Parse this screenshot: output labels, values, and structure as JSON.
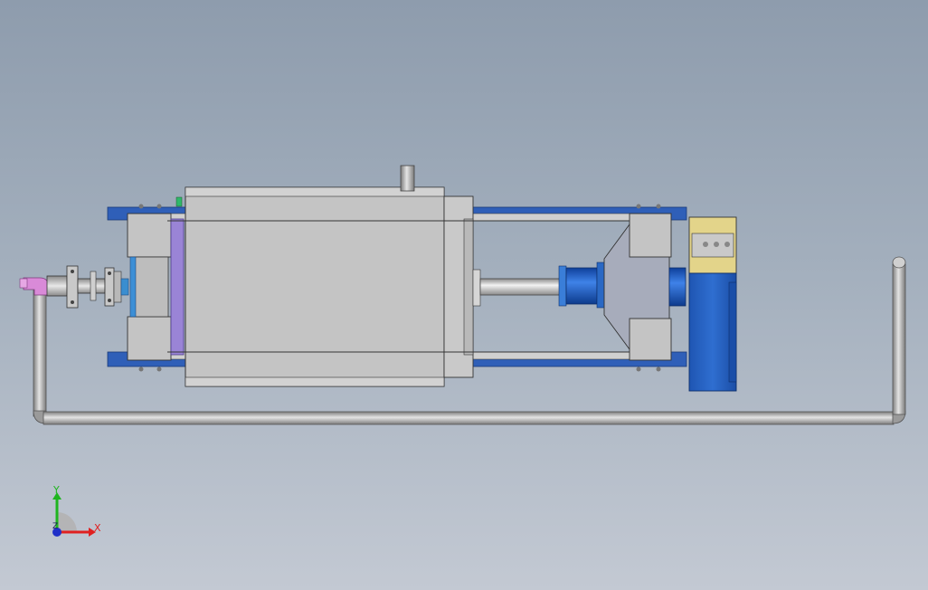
{
  "viewport": {
    "background_top": "#8e9cad",
    "background_bottom": "#c3c9d3"
  },
  "model": {
    "colors": {
      "body_gray": "#c4c4c4",
      "frame_blue": "#2f5fb8",
      "motor_blue": "#2a66c6",
      "coupling_blue": "#1d5fd0",
      "pipe_gray": "#9a9a9a",
      "seal_purple": "#9a84d6",
      "fitting_pink": "#d98ad8",
      "sensor_yellow": "#e3d48a"
    }
  },
  "triad": {
    "x_label": "X",
    "y_label": "Y",
    "z_label": "Z",
    "x_color": "#e02020",
    "y_color": "#1fb51f",
    "z_color": "#2030c8"
  }
}
